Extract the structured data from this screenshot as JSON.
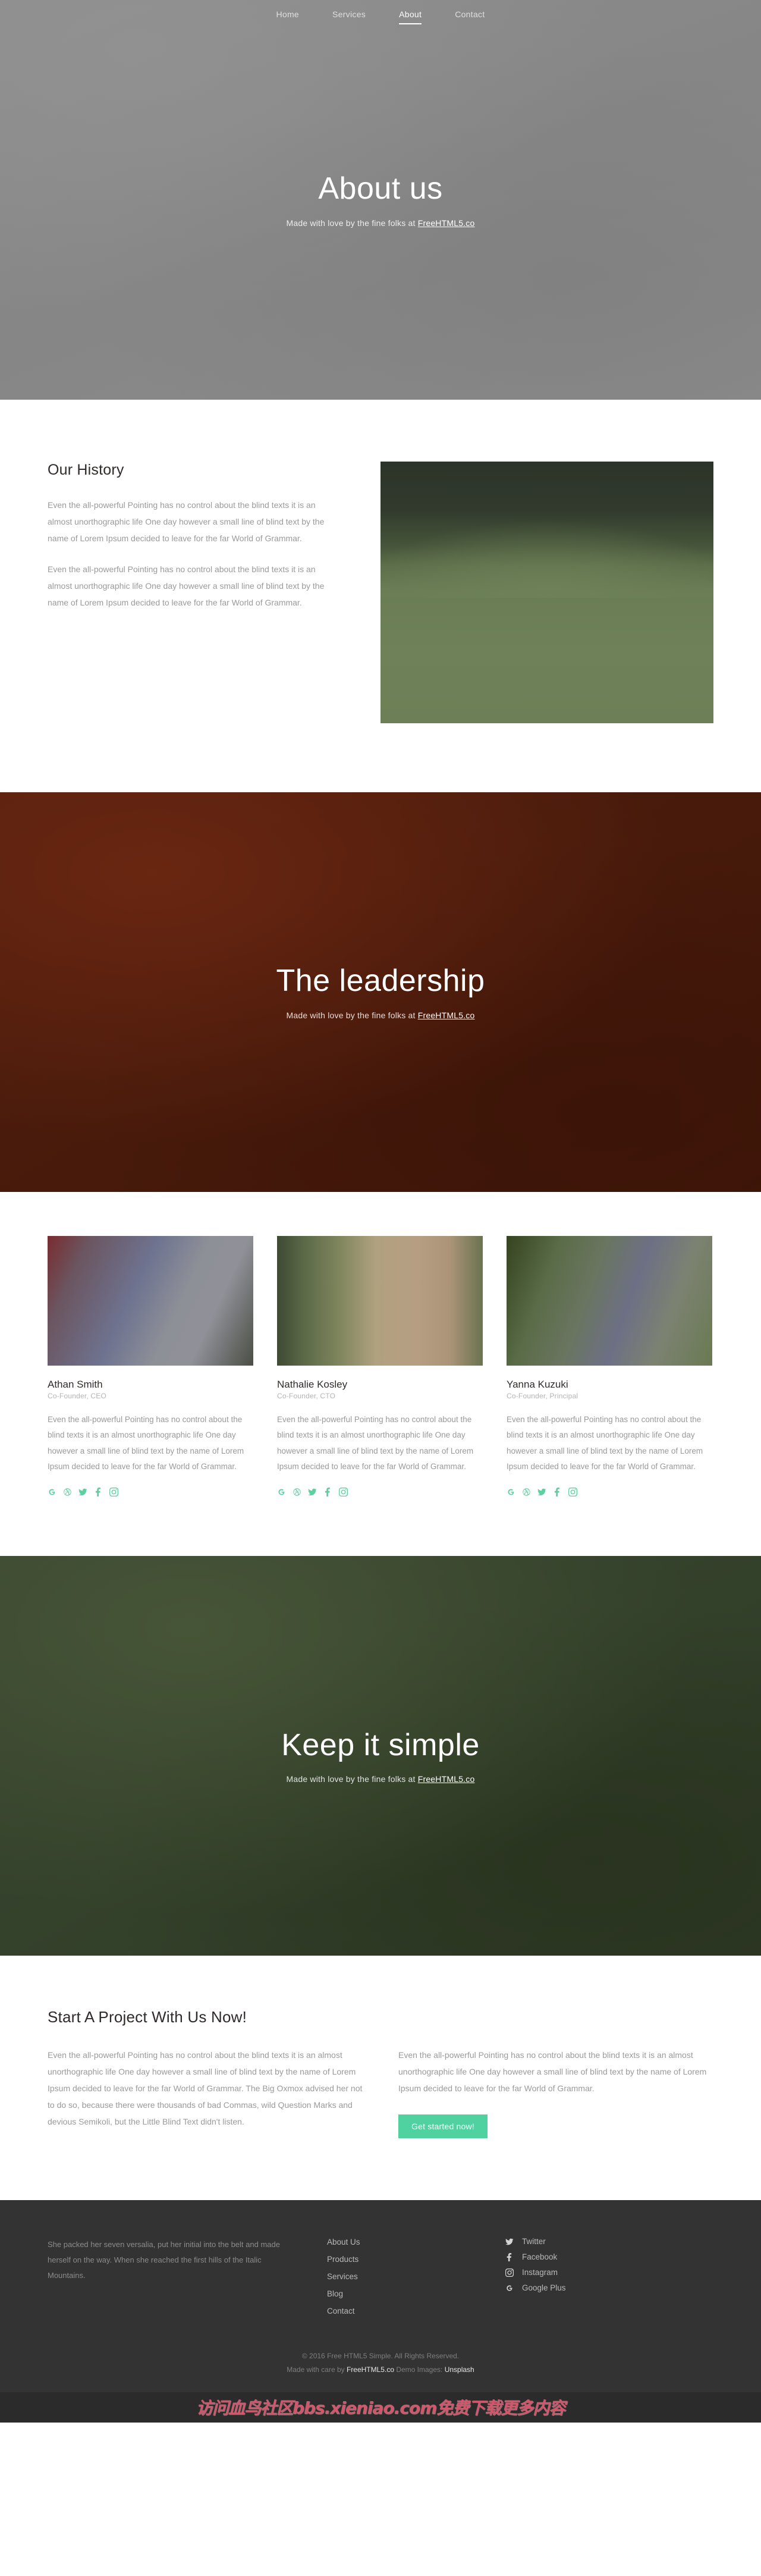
{
  "nav": {
    "items": [
      {
        "label": "Home",
        "active": false
      },
      {
        "label": "Services",
        "active": false
      },
      {
        "label": "About",
        "active": true
      },
      {
        "label": "Contact",
        "active": false
      }
    ]
  },
  "hero_about": {
    "title": "About us",
    "subtitle_prefix": "Made with love by the fine folks at ",
    "subtitle_link": "FreeHTML5.co",
    "bg_color": "#8a8a8a"
  },
  "history": {
    "heading": "Our History",
    "paragraphs": [
      "Even the all-powerful Pointing has no control about the blind texts it is an almost unorthographic life One day however a small line of blind text by the name of Lorem Ipsum decided to leave for the far World of Grammar.",
      "Even the all-powerful Pointing has no control about the blind texts it is an almost unorthographic life One day however a small line of blind text by the name of Lorem Ipsum decided to leave for the far World of Grammar."
    ],
    "image_alt": "green-landscape-photo"
  },
  "hero_leadership": {
    "title": "The leadership",
    "subtitle_prefix": "Made with love by the fine folks at ",
    "subtitle_link": "FreeHTML5.co",
    "bg_color": "#4d1c0c"
  },
  "team": {
    "social_color": "#5dd0a0",
    "members": [
      {
        "name": "Athan Smith",
        "role": "Co-Founder, CEO",
        "bio": "Even the all-powerful Pointing has no control about the blind texts it is an almost unorthographic life One day however a small line of blind text by the name of Lorem Ipsum decided to leave for the far World of Grammar.",
        "socials": [
          "google-icon",
          "dribbble-icon",
          "twitter-icon",
          "facebook-icon",
          "instagram-icon"
        ]
      },
      {
        "name": "Nathalie Kosley",
        "role": "Co-Founder, CTO",
        "bio": "Even the all-powerful Pointing has no control about the blind texts it is an almost unorthographic life One day however a small line of blind text by the name of Lorem Ipsum decided to leave for the far World of Grammar.",
        "socials": [
          "google-icon",
          "dribbble-icon",
          "twitter-icon",
          "facebook-icon",
          "instagram-icon"
        ]
      },
      {
        "name": "Yanna Kuzuki",
        "role": "Co-Founder, Principal",
        "bio": "Even the all-powerful Pointing has no control about the blind texts it is an almost unorthographic life One day however a small line of blind text by the name of Lorem Ipsum decided to leave for the far World of Grammar.",
        "socials": [
          "google-icon",
          "dribbble-icon",
          "twitter-icon",
          "facebook-icon",
          "instagram-icon"
        ]
      }
    ]
  },
  "hero_simple": {
    "title": "Keep it simple",
    "subtitle_prefix": "Made with love by the fine folks at ",
    "subtitle_link": "FreeHTML5.co",
    "bg_color": "#35412a"
  },
  "cta": {
    "heading": "Start A Project With Us Now!",
    "left_paragraph": "Even the all-powerful Pointing has no control about the blind texts it is an almost unorthographic life One day however a small line of blind text by the name of Lorem Ipsum decided to leave for the far World of Grammar. The Big Oxmox advised her not to do so, because there were thousands of bad Commas, wild Question Marks and devious Semikoli, but the Little Blind Text didn't listen.",
    "right_paragraph": "Even the all-powerful Pointing has no control about the blind texts it is an almost unorthographic life One day however a small line of blind text by the name of Lorem Ipsum decided to leave for the far World of Grammar.",
    "button_label": "Get started now!",
    "button_color": "#4fd1a0"
  },
  "footer": {
    "about_text": "She packed her seven versalia, put her initial into the belt and made herself on the way. When she reached the first hills of the Italic Mountains.",
    "links": [
      "About Us",
      "Products",
      "Services",
      "Blog",
      "Contact"
    ],
    "socials": [
      {
        "label": "Twitter",
        "icon": "twitter-icon"
      },
      {
        "label": "Facebook",
        "icon": "facebook-icon"
      },
      {
        "label": "Instagram",
        "icon": "instagram-icon"
      },
      {
        "label": "Google Plus",
        "icon": "google-plus-icon"
      }
    ],
    "copyright_line1": "© 2016 Free HTML5 Simple. All Rights Reserved.",
    "credit_prefix": "Made with care by ",
    "credit_link1": "FreeHTML5.co",
    "credit_middle": " Demo Images: ",
    "credit_link2": "Unsplash"
  },
  "watermark": {
    "text": "访问血鸟社区bbs.xieniao.com免费下载更多内容"
  }
}
